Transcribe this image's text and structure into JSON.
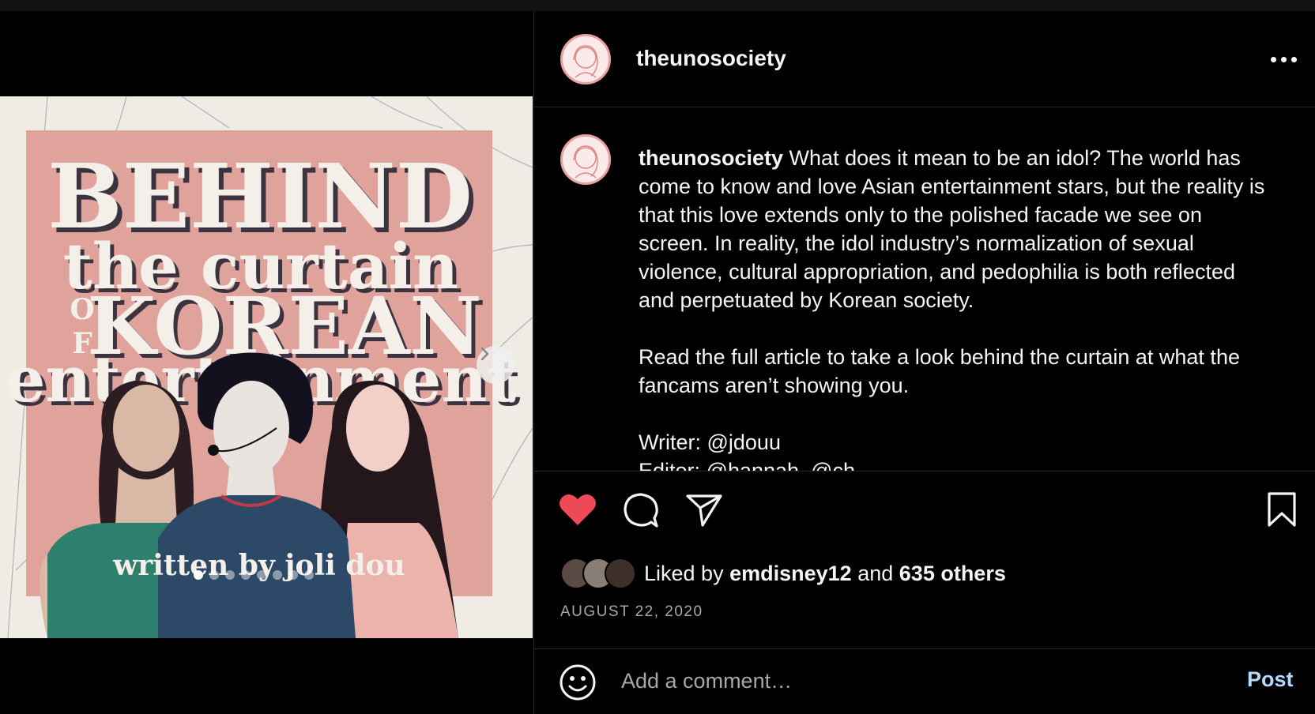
{
  "post": {
    "username": "theunosociety",
    "caption_username": "theunosociety",
    "caption_p1": "What does it mean to be an idol? The world has come to know and love Asian entertainment stars, but the reality is that this love extends only to the polished facade we see on screen. In reality, the idol industry’s normalization of sexual violence, cultural appropriation, and pedophilia is both reflected and perpetuated by Korean society.",
    "caption_p2": "Read the full article to take a look behind the curtain at what the fancams aren’t showing you.",
    "caption_p3": "Writer: @jdouu",
    "caption_p4": "Editor: @hannah_@ch..."
  },
  "image_text": {
    "line1": "BEHIND",
    "line2": "the curtain",
    "line3a": "O",
    "line3b": "F",
    "line3": "KOREAN",
    "line4": "entertainment",
    "byline": "written by joli dou"
  },
  "carousel": {
    "count": 8,
    "active_index": 0
  },
  "likes": {
    "prefix": "Liked by",
    "user": "emdisney12",
    "joiner": "and",
    "others": "635 others"
  },
  "date": "AUGUST 22, 2020",
  "comment": {
    "placeholder": "Add a comment…",
    "post_label": "Post"
  },
  "colors": {
    "like_red": "#ed4956",
    "post_blue": "#b3dbff",
    "image_pink": "#dfa39c"
  },
  "icons": [
    "heart-icon",
    "comment-icon",
    "share-icon",
    "bookmark-icon",
    "emoji-icon",
    "more-icon",
    "chevron-right-icon"
  ]
}
